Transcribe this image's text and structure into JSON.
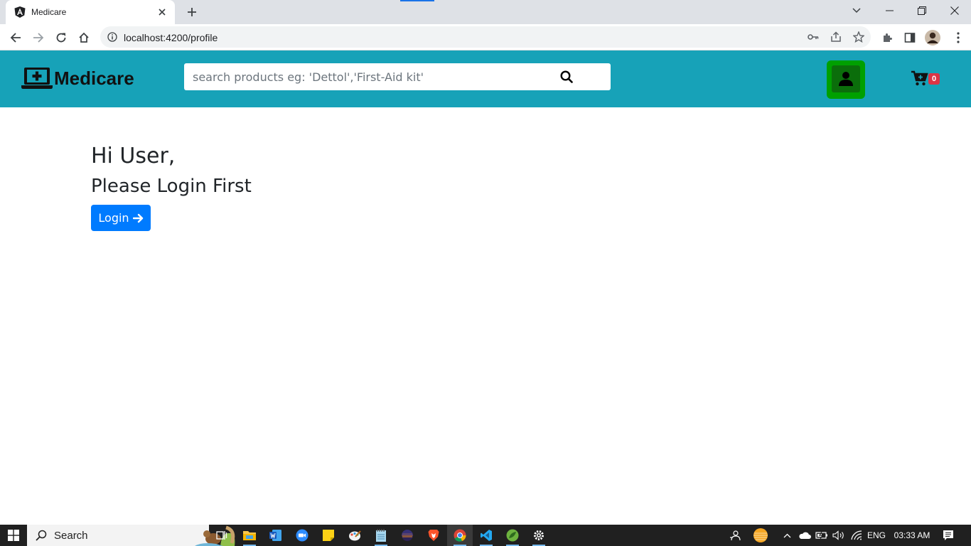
{
  "browser": {
    "tab_title": "Medicare",
    "url": "localhost:4200/profile"
  },
  "navbar": {
    "brand_name": "Medicare",
    "search_placeholder": "search products eg: 'Dettol','First-Aid kit'",
    "cart_count": "0",
    "colors": {
      "background": "#17a2b8",
      "profile_highlight": "#00a000",
      "badge": "#dc3545"
    }
  },
  "main": {
    "greeting": "Hi User,",
    "prompt": "Please Login First",
    "login_label": "Login"
  },
  "taskbar": {
    "search_label": "Search",
    "language": "ENG",
    "time": "03:33 AM",
    "apps": [
      "task-view",
      "file-explorer",
      "word",
      "zoom",
      "sticky-notes",
      "paint",
      "notepad",
      "eclipse",
      "brave",
      "chrome",
      "vscode",
      "spring-tool-suite",
      "settings"
    ]
  }
}
